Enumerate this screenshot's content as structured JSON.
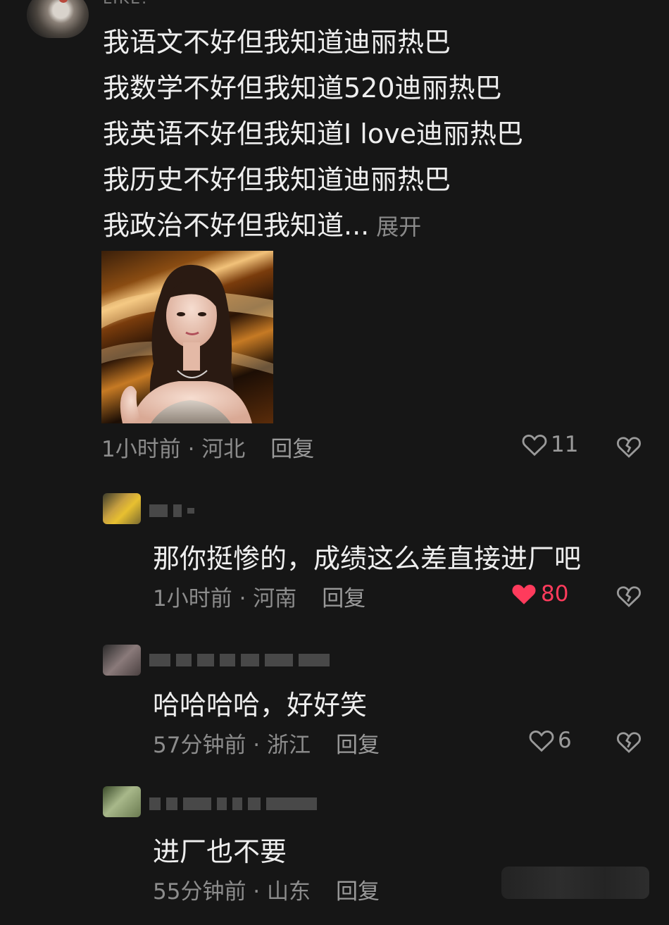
{
  "main_comment": {
    "username": "LIKE.",
    "lines": [
      "我语文不好但我知道迪丽热巴",
      "我数学不好但我知道520迪丽热巴",
      "我英语不好但我知道I love迪丽热巴",
      "我历史不好但我知道迪丽热巴",
      "我政治不好但我知道..."
    ],
    "expand_label": "展开",
    "time_location": "1小时前 · 河北",
    "reply_label": "回复",
    "likes": "11"
  },
  "replies": [
    {
      "text": "那你挺惨的，成绩这么差直接进厂吧",
      "time_location": "1小时前 · 河南",
      "reply_label": "回复",
      "likes": "80",
      "liked": true
    },
    {
      "text": "哈哈哈哈，好好笑",
      "time_location": "57分钟前 · 浙江",
      "reply_label": "回复",
      "likes": "6",
      "liked": false
    },
    {
      "text": "进厂也不要",
      "time_location": "55分钟前 · 山东",
      "reply_label": "回复",
      "likes": "",
      "liked": false
    }
  ],
  "colors": {
    "background": "#161616",
    "text": "#eeeeee",
    "meta": "#8c8c8c",
    "like_active": "#ff3b5c"
  }
}
